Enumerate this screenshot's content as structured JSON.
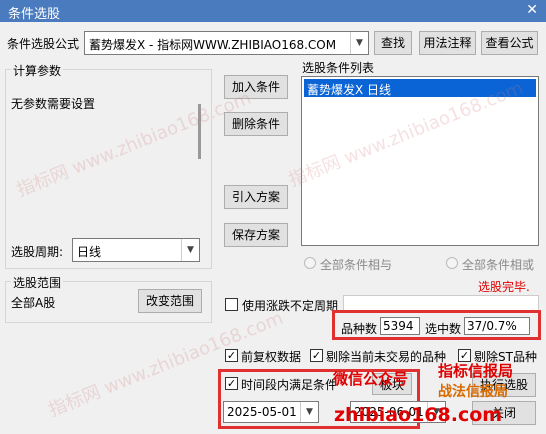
{
  "window": {
    "title": "条件选股",
    "close_glyph": "✕"
  },
  "formula": {
    "label": "条件选股公式",
    "value": "蓄势爆发X  - 指标网WWW.ZHIBIAO168.COM"
  },
  "buttons": {
    "find": "查找",
    "usage": "用法注释",
    "view_formula": "查看公式",
    "add_condition": "加入条件",
    "delete_condition": "删除条件",
    "import_plan": "引入方案",
    "save_plan": "保存方案",
    "change_range": "改变范围",
    "execute": "执行选股",
    "close": "关闭"
  },
  "calc_params": {
    "legend": "计算参数",
    "message": "无参数需要设置",
    "period_label": "选股周期:",
    "period_value": "日线"
  },
  "condition_list": {
    "legend": "选股条件列表",
    "items": [
      "蓄势爆发X  日线"
    ]
  },
  "logic": {
    "all_and": "全部条件相与",
    "all_or": "全部条件相或"
  },
  "status": {
    "text": "选股完毕.",
    "color": "#e00000"
  },
  "range": {
    "legend": "选股范围",
    "value": "全部A股"
  },
  "dynamic_period": {
    "label": "使用涨跌不定周期"
  },
  "stats": {
    "count_label": "品种数",
    "count_value": "5394",
    "selected_label": "选中数",
    "selected_value": "37/0.7%",
    "highlight_color": "#e03030"
  },
  "options": {
    "prior_rights": "前复权数据",
    "exclude_untraded": "剔除当前未交易的品种",
    "exclude_st": "剔除ST品种"
  },
  "time_range": {
    "label": "时间段内满足条件",
    "start": "2025-05-01",
    "end": "2025-06-01",
    "board_label": "板块"
  },
  "watermarks": {
    "site": "指标网 www.zhibiao168.com",
    "wechat": "微信公众号",
    "brand": "指标信报局",
    "slogan": "战法信报局",
    "url": "zhibiao168.com"
  }
}
